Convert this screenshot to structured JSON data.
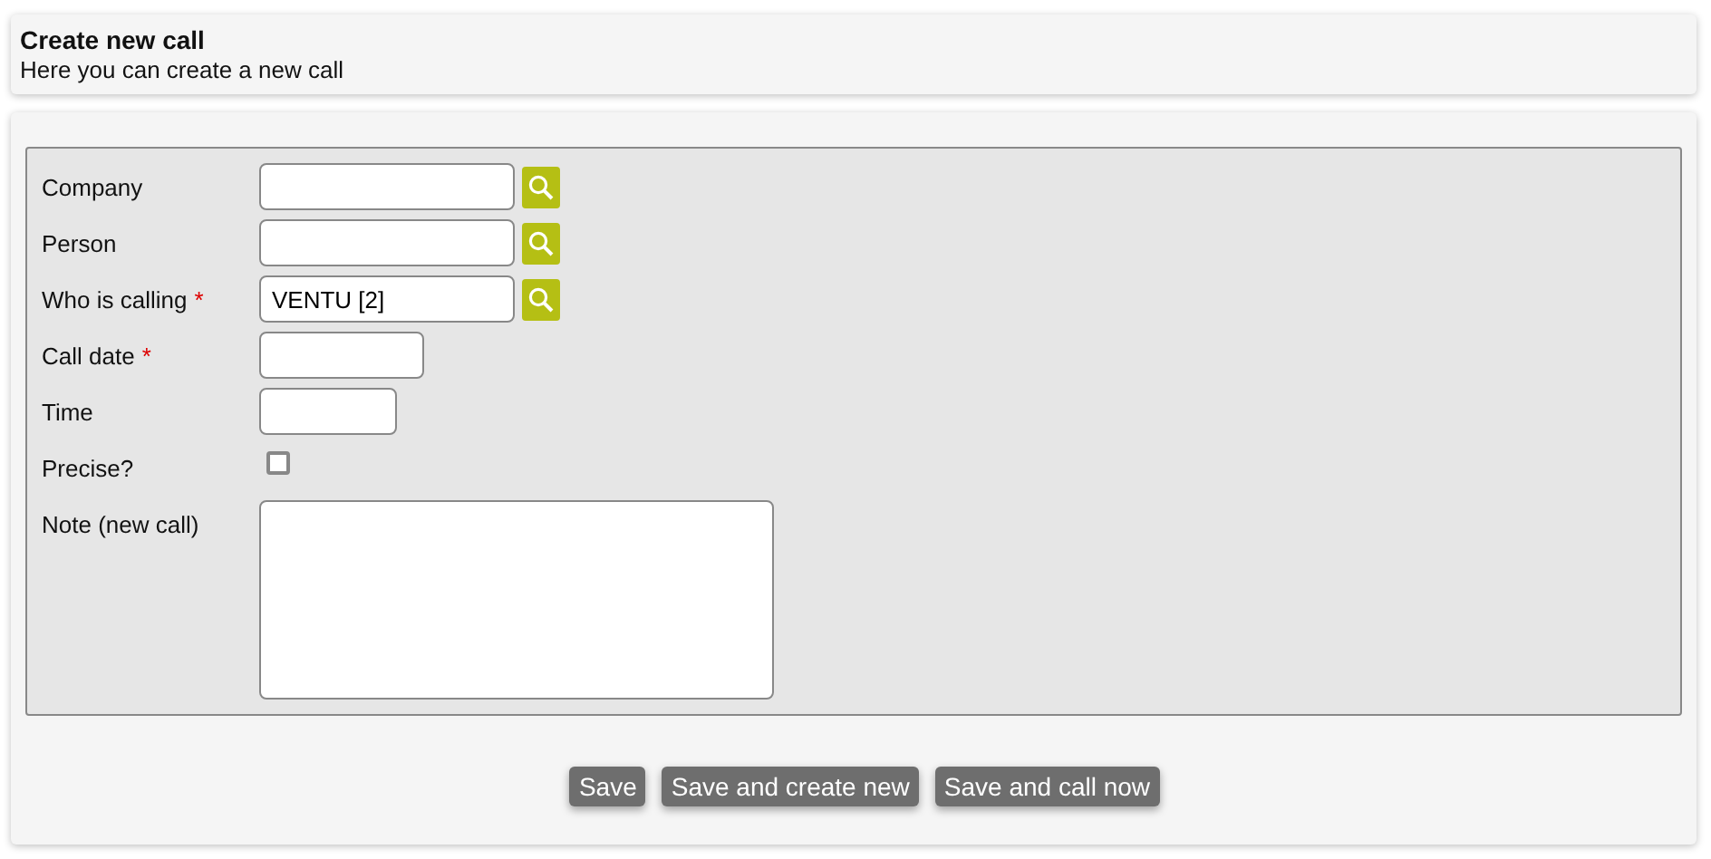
{
  "header": {
    "title": "Create new call",
    "subtitle": "Here you can create a new call"
  },
  "fields": [
    {
      "label": "Company",
      "kind": "lookup"
    },
    {
      "label": "Person",
      "kind": "lookup"
    },
    {
      "label": "Who is calling",
      "kind": "lookup",
      "required_mark": "*",
      "value": "VENTU [2]"
    },
    {
      "label": "Call date",
      "kind": "date",
      "required_mark": "*"
    },
    {
      "label": "Time",
      "kind": "time"
    },
    {
      "label": "Precise?",
      "kind": "checkbox",
      "checked": false
    },
    {
      "label": "Note (new call)",
      "kind": "textarea"
    }
  ],
  "buttons": [
    "Save",
    "Save and create new",
    "Save and call now"
  ]
}
